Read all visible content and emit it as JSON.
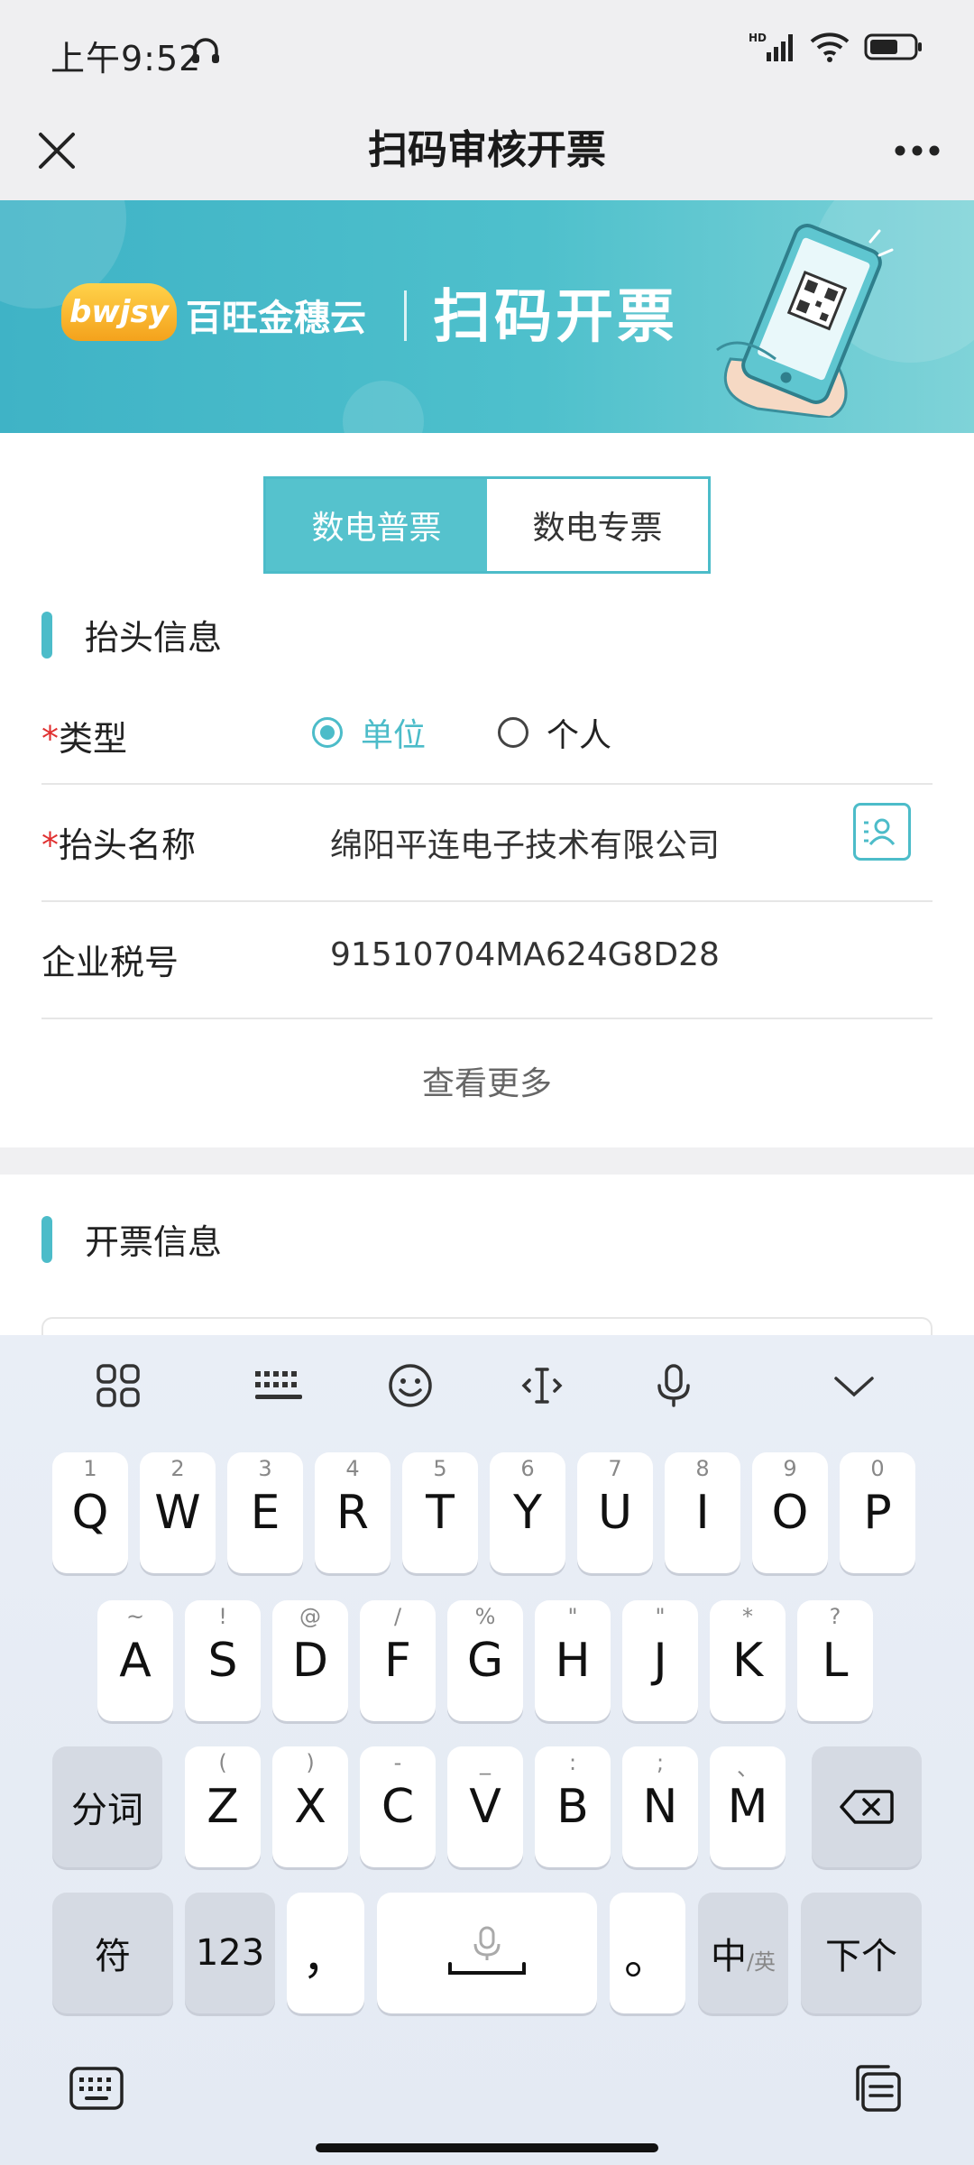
{
  "status_bar": {
    "time": "上午9:52",
    "network": "HD"
  },
  "header": {
    "title": "扫码审核开票"
  },
  "banner": {
    "brand_logo": "bwjsy",
    "brand_name": "百旺金穗云",
    "title": "扫码开票"
  },
  "invoice_tabs": [
    {
      "label": "数电普票",
      "selected": true
    },
    {
      "label": "数电专票",
      "selected": false
    }
  ],
  "header_info": {
    "section_title": "抬头信息",
    "type_label": "类型",
    "type_options": [
      {
        "label": "单位",
        "selected": true
      },
      {
        "label": "个人",
        "selected": false
      }
    ],
    "name_label": "抬头名称",
    "name_value": "绵阳平连电子技术有限公司",
    "tax_label": "企业税号",
    "tax_value": "91510704MA624G8D28",
    "view_more": "查看更多"
  },
  "invoice_info": {
    "section_title": "开票信息"
  },
  "keyboard": {
    "row1": [
      {
        "main": "Q",
        "sub": "1"
      },
      {
        "main": "W",
        "sub": "2"
      },
      {
        "main": "E",
        "sub": "3"
      },
      {
        "main": "R",
        "sub": "4"
      },
      {
        "main": "T",
        "sub": "5"
      },
      {
        "main": "Y",
        "sub": "6"
      },
      {
        "main": "U",
        "sub": "7"
      },
      {
        "main": "I",
        "sub": "8"
      },
      {
        "main": "O",
        "sub": "9"
      },
      {
        "main": "P",
        "sub": "0"
      }
    ],
    "row2": [
      {
        "main": "A",
        "sub": "~"
      },
      {
        "main": "S",
        "sub": "!"
      },
      {
        "main": "D",
        "sub": "@"
      },
      {
        "main": "F",
        "sub": "/"
      },
      {
        "main": "G",
        "sub": "%"
      },
      {
        "main": "H",
        "sub": "\""
      },
      {
        "main": "J",
        "sub": "\""
      },
      {
        "main": "K",
        "sub": "*"
      },
      {
        "main": "L",
        "sub": "?"
      }
    ],
    "row3": [
      {
        "main": "Z",
        "sub": "("
      },
      {
        "main": "X",
        "sub": ")"
      },
      {
        "main": "C",
        "sub": "-"
      },
      {
        "main": "V",
        "sub": "_"
      },
      {
        "main": "B",
        "sub": ":"
      },
      {
        "main": "N",
        "sub": ";"
      },
      {
        "main": "M",
        "sub": "、"
      }
    ],
    "segment_key": "分词",
    "symbol_key": "符",
    "number_key": "123",
    "comma_key": "，",
    "period_key": "。",
    "lang_key_main": "中",
    "lang_key_sub": "/英",
    "next_key": "下个"
  }
}
